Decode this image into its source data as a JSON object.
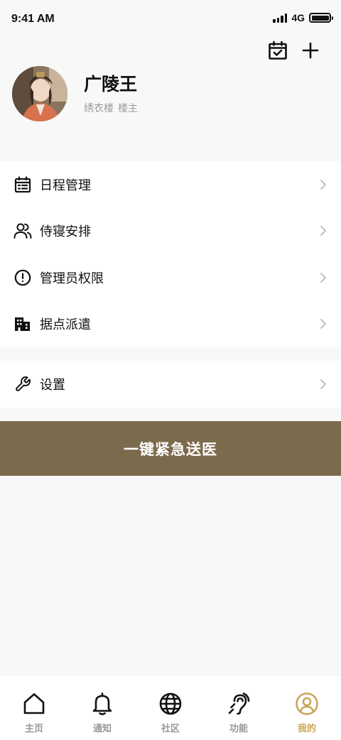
{
  "status_bar": {
    "time": "9:41 AM",
    "network": "4G"
  },
  "top_actions": {
    "calendar_icon": "calendar-check-icon",
    "add_icon": "plus-icon"
  },
  "profile": {
    "name": "广陵王",
    "org": "绣衣楼",
    "role": "楼主"
  },
  "menu_group_1": [
    {
      "label": "日程管理",
      "icon": "calendar-list-icon"
    },
    {
      "label": "侍寝安排",
      "icon": "users-icon"
    },
    {
      "label": "管理员权限",
      "icon": "alert-circle-icon"
    },
    {
      "label": "据点派遣",
      "icon": "buildings-icon"
    }
  ],
  "menu_group_2": [
    {
      "label": "设置",
      "icon": "wrench-icon"
    }
  ],
  "emergency": {
    "label": "一键紧急送医",
    "color": "#7c6a4d"
  },
  "tabs": [
    {
      "label": "主页",
      "icon": "home-icon"
    },
    {
      "label": "通知",
      "icon": "bell-icon"
    },
    {
      "label": "社区",
      "icon": "globe-icon"
    },
    {
      "label": "功能",
      "icon": "hearing-icon"
    },
    {
      "label": "我的",
      "icon": "user-circle-icon",
      "active": true
    }
  ],
  "colors": {
    "accent": "#c9a55a",
    "brand_button": "#7c6a4d"
  }
}
